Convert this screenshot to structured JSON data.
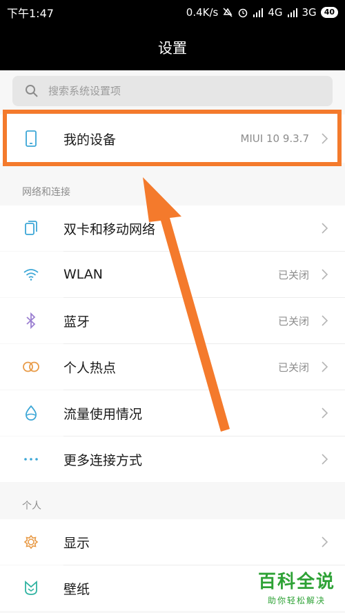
{
  "status_bar": {
    "time": "下午1:47",
    "network_speed": "0.4K/s",
    "network_1": "4G",
    "network_2": "3G",
    "battery": "40"
  },
  "header": {
    "title": "设置"
  },
  "search": {
    "placeholder": "搜索系统设置项"
  },
  "device_row": {
    "label": "我的设备",
    "value": "MIUI 10 9.3.7",
    "icon": "phone-icon"
  },
  "sections": {
    "network": {
      "title": "网络和连接",
      "items": [
        {
          "label": "双卡和移动网络",
          "value": "",
          "icon": "sim-card-icon"
        },
        {
          "label": "WLAN",
          "value": "已关闭",
          "icon": "wifi-icon"
        },
        {
          "label": "蓝牙",
          "value": "已关闭",
          "icon": "bluetooth-icon"
        },
        {
          "label": "个人热点",
          "value": "已关闭",
          "icon": "hotspot-icon"
        },
        {
          "label": "流量使用情况",
          "value": "",
          "icon": "data-usage-icon"
        },
        {
          "label": "更多连接方式",
          "value": "",
          "icon": "more-dots-icon"
        }
      ]
    },
    "personal": {
      "title": "个人",
      "items": [
        {
          "label": "显示",
          "value": "",
          "icon": "brightness-icon"
        },
        {
          "label": "壁纸",
          "value": "",
          "icon": "wallpaper-icon"
        }
      ]
    }
  },
  "watermark": {
    "title": "百科全说",
    "subtitle": "助你轻松解决"
  },
  "colors": {
    "accent_icon": "#3ba6d6",
    "highlight": "#f47a2c",
    "watermark": "#2ea236"
  }
}
